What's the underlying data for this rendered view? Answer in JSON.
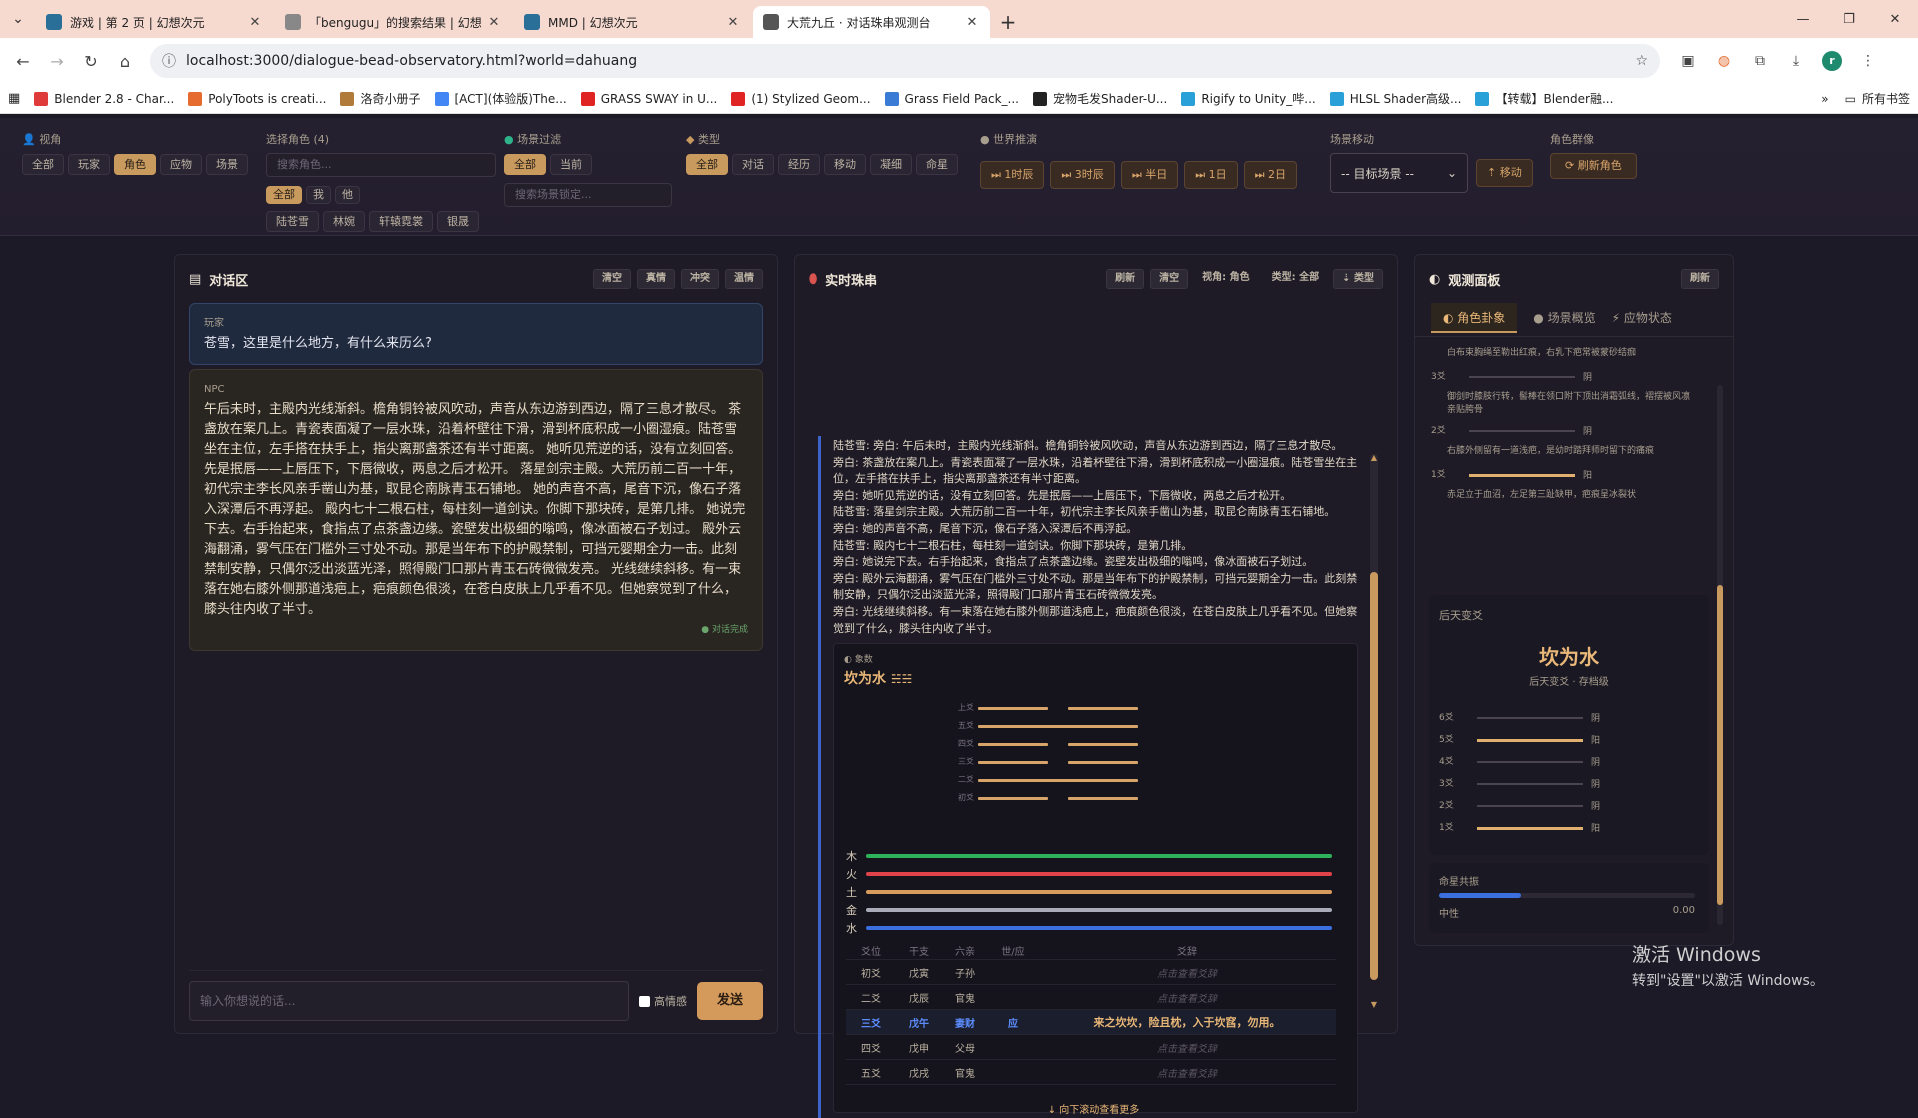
{
  "browser": {
    "tabs": [
      {
        "title": "游戏 | 第 2 页 | 幻想次元",
        "color": "#2a6f97"
      },
      {
        "title": "「bengugu」的搜索结果 | 幻想",
        "color": "#888"
      },
      {
        "title": "MMD | 幻想次元",
        "color": "#2a6f97"
      },
      {
        "title": "大荒九丘 · 对话珠串观测台",
        "color": "#555"
      }
    ],
    "url": "localhost:3000/dialogue-bead-observatory.html?world=dahuang",
    "bookmarks": [
      {
        "label": "Blender 2.8 - Char...",
        "color": "#e03b3b"
      },
      {
        "label": "PolyToots is creati...",
        "color": "#e56b2e"
      },
      {
        "label": "洛奇小册子",
        "color": "#b07a3b"
      },
      {
        "label": "[ACT](体验版)The...",
        "color": "#4285f4"
      },
      {
        "label": "GRASS SWAY in U...",
        "color": "#e02424"
      },
      {
        "label": "(1) Stylized Geom...",
        "color": "#e02424"
      },
      {
        "label": "Grass Field Pack_...",
        "color": "#3a7bd5"
      },
      {
        "label": "宠物毛发Shader-U...",
        "color": "#222"
      },
      {
        "label": "Rigify to Unity_哔...",
        "color": "#29a0d8"
      },
      {
        "label": "HLSL Shader高级...",
        "color": "#29a0d8"
      },
      {
        "label": "【转载】Blender融...",
        "color": "#29a0d8"
      }
    ],
    "all_bookmarks": "所有书签"
  },
  "filters": {
    "view": {
      "label": "视角",
      "options": [
        "全部",
        "玩家",
        "角色",
        "应物",
        "场景"
      ],
      "active": "角色"
    },
    "role": {
      "label": "选择角色",
      "count": "(4)",
      "placeholder": "搜索角色...",
      "tags": [
        "全部",
        "我",
        "他"
      ],
      "names": [
        "陆苍雪",
        "林婉",
        "轩辕霓裳",
        "银晟"
      ]
    },
    "scene": {
      "label": "场景过滤",
      "options": [
        "全部",
        "当前"
      ],
      "placeholder": "搜索场景锁定..."
    },
    "type": {
      "label": "类型",
      "options": [
        "全部",
        "对话",
        "经历",
        "移动",
        "凝细",
        "命星"
      ]
    },
    "world": {
      "label": "世界推演",
      "buttons": [
        "⏭ 1时辰",
        "⏭ 3时辰",
        "⏭ 半日",
        "⏭ 1日",
        "⏭ 2日"
      ]
    },
    "move": {
      "label": "场景移动",
      "select": "-- 目标场景 --",
      "button": "⇡ 移动"
    },
    "cast": {
      "label": "角色群像",
      "button": "⟳ 刷新角色"
    }
  },
  "dialog": {
    "title": "对话区",
    "tools": [
      "清空",
      "真情",
      "冲突",
      "温情"
    ],
    "player_label": "玩家",
    "player_text": "苍雪，这里是什么地方，有什么来历么?",
    "npc_label": "NPC",
    "npc_text": "午后未时，主殿内光线渐斜。檐角铜铃被风吹动，声音从东边游到西边，隔了三息才散尽。 茶盏放在案几上。青瓷表面凝了一层水珠，沿着杯壁往下滑，滑到杯底积成一小圈湿痕。陆苍雪坐在主位，左手搭在扶手上，指尖离那盏茶还有半寸距离。 她听见荒逆的话，没有立刻回答。先是抿唇——上唇压下，下唇微收，两息之后才松开。 落星剑宗主殿。大荒历前二百一十年，初代宗主李长风亲手凿山为基，取昆仑南脉青玉石铺地。 她的声音不高，尾音下沉，像石子落入深潭后不再浮起。 殿内七十二根石柱，每柱刻一道剑诀。你脚下那块砖，是第几排。 她说完下去。右手抬起来，食指点了点茶盏边缘。瓷壁发出极细的嗡鸣，像冰面被石子划过。 殿外云海翻涌，雾气压在门槛外三寸处不动。那是当年布下的护殿禁制，可挡元婴期全力一击。此刻禁制安静，只偶尔泛出淡蓝光泽，照得殿门口那片青玉石砖微微发亮。 光线继续斜移。有一束落在她右膝外侧那道浅疤上，疤痕颜色很淡，在苍白皮肤上几乎看不见。但她察觉到了什么，膝头往内收了半寸。",
    "done": "● 对话完成",
    "input_placeholder": "输入你想说的话...",
    "emotion_label": "高情感",
    "send": "发送"
  },
  "beads": {
    "title": "实时珠串",
    "tools": [
      "刷新",
      "清空"
    ],
    "view_select": "视角: 角色",
    "type_select": "类型: 全部",
    "type_btn": "⇣ 类型",
    "lines": [
      "陆苍雪: 旁白: 午后未时，主殿内光线渐斜。檐角铜铃被风吹动，声音从东边游到西边，隔了三息才散尽。",
      "旁白: 茶盏放在案几上。青瓷表面凝了一层水珠，沿着杯壁往下滑，滑到杯底积成一小圈湿痕。陆苍雪坐在主位，左手搭在扶手上，指尖离那盏茶还有半寸距离。",
      "旁白: 她听见荒逆的话，没有立刻回答。先是抿唇——上唇压下，下唇微收，两息之后才松开。",
      "陆苍雪: 落星剑宗主殿。大荒历前二百一十年，初代宗主李长风亲手凿山为基，取昆仑南脉青玉石铺地。",
      "旁白: 她的声音不高，尾音下沉，像石子落入深潭后不再浮起。",
      "陆苍雪: 殿内七十二根石柱，每柱刻一道剑诀。你脚下那块砖，是第几排。",
      "旁白: 她说完下去。右手抬起来，食指点了点茶盏边缘。瓷壁发出极细的嗡鸣，像冰面被石子划过。",
      "旁白: 殿外云海翻涌，雾气压在门槛外三寸处不动。那是当年布下的护殿禁制，可挡元婴期全力一击。此刻禁制安静，只偶尔泛出淡蓝光泽，照得殿门口那片青玉石砖微微发亮。",
      "旁白: 光线继续斜移。有一束落在她右膝外侧那道浅疤上，疤痕颜色很淡，在苍白皮肤上几乎看不见。但她察觉到了什么，膝头往内收了半寸。"
    ],
    "hex_tag": "◐ 象数",
    "hex_name": "坎为水",
    "hex_glyph": "☵☵",
    "hex_lines": [
      {
        "label": "上爻",
        "yang": false
      },
      {
        "label": "五爻",
        "yang": true
      },
      {
        "label": "四爻",
        "yang": false
      },
      {
        "label": "三爻",
        "yang": false
      },
      {
        "label": "二爻",
        "yang": true
      },
      {
        "label": "初爻",
        "yang": false
      }
    ],
    "elements": [
      {
        "label": "木",
        "color": "#2fb35a",
        "level": 1.0
      },
      {
        "label": "火",
        "color": "#e0434a",
        "level": 1.0
      },
      {
        "label": "土",
        "color": "#d79b5d",
        "level": 1.0
      },
      {
        "label": "金",
        "color": "#a9abb8",
        "level": 1.0
      },
      {
        "label": "水",
        "color": "#3b6fe0",
        "level": 1.0
      }
    ],
    "table_head": [
      "爻位",
      "干支",
      "六亲",
      "世/应",
      "爻辞"
    ],
    "table_rows": [
      [
        "初爻",
        "戊寅",
        "子孙",
        "",
        "点击查看爻辞"
      ],
      [
        "二爻",
        "戊辰",
        "官鬼",
        "",
        "点击查看爻辞"
      ],
      [
        "三爻",
        "戊午",
        "妻财",
        "应",
        "来之坎坎，险且枕，入于坎窞，勿用。"
      ],
      [
        "四爻",
        "戊申",
        "父母",
        "",
        "点击查看爻辞"
      ],
      [
        "五爻",
        "戊戌",
        "官鬼",
        "",
        "点击查看爻辞"
      ]
    ],
    "more": "↓ 向下滚动查看更多"
  },
  "observe": {
    "title": "观测面板",
    "refresh": "刷新",
    "tabs": [
      "◐ 角色卦象",
      "● 场景概览",
      "⚡ 应物状态"
    ],
    "top_lines": [
      {
        "label": "",
        "text": "白布束胸绳至勒出红痕，右乳下疤常被蒙砂结痂",
        "bar": false
      },
      {
        "label": "3爻",
        "text": "",
        "bar": true,
        "yang": false,
        "v": "阴"
      },
      {
        "label": "",
        "text": "御剑时膝肢行转，髻棒在领口附下顶出消霜弧线，褶摆被风凛亲贴胯骨",
        "bar": false
      },
      {
        "label": "2爻",
        "text": "",
        "bar": true,
        "yang": false,
        "v": "阴"
      },
      {
        "label": "",
        "text": "右膝外侧留有一道浅疤，是幼时踏拜师时留下的痛痕",
        "bar": false
      },
      {
        "label": "1爻",
        "text": "",
        "bar": true,
        "yang": true,
        "v": "阳"
      },
      {
        "label": "",
        "text": "赤足立于血沼，左足第三趾缺甲，疤痕呈冰裂状",
        "bar": false
      }
    ],
    "later_title": "后天变爻",
    "later_name": "坎为水",
    "later_sub": "后天变爻 · 存档级",
    "later_lines": [
      {
        "label": "6爻",
        "yang": false,
        "v": "阴"
      },
      {
        "label": "5爻",
        "yang": true,
        "v": "阳"
      },
      {
        "label": "4爻",
        "yang": false,
        "v": "阴"
      },
      {
        "label": "3爻",
        "yang": false,
        "v": "阴"
      },
      {
        "label": "2爻",
        "yang": false,
        "v": "阴"
      },
      {
        "label": "1爻",
        "yang": true,
        "v": "阳"
      }
    ],
    "resonance_title": "命星共振",
    "resonance_state": "中性",
    "resonance_value": "0.00",
    "resonance_level": 0.32
  },
  "watermark": {
    "line1": "激活 Windows",
    "line2": "转到\"设置\"以激活 Windows。"
  }
}
